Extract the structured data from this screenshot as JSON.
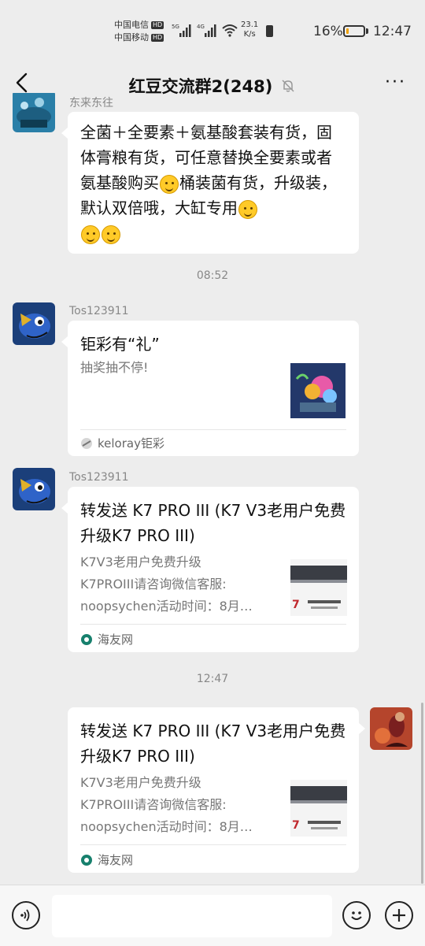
{
  "status_bar": {
    "carrier1": "中国电信",
    "carrier2": "中国移动",
    "hd": "HD",
    "sig1_label": "5G",
    "sig2_label": "4G",
    "net_speed": "23.1",
    "net_unit": "K/s",
    "battery": "16%",
    "time": "12:47",
    "battery_level_percent": 16
  },
  "header": {
    "title": "红豆交流群2(248)",
    "muted_icon": "bell-off-icon",
    "more_label": "···"
  },
  "messages": {
    "m0": {
      "sender": "东来东往",
      "text_before": "全菌＋全要素＋氨基酸套装有货，固体膏粮有货，可任意替换全要素或者氨基酸购买",
      "text_middle": "桶装菌有货，升级装，默认双倍哦，大缸专用",
      "emoji_icons": [
        "grin-icon",
        "smirk-icon",
        "smirk-icon",
        "smirk-icon"
      ]
    },
    "t1": "08:52",
    "m1": {
      "sender": "Tos123911",
      "title": "钜彩有“礼”",
      "desc": "抽奖抽不停!",
      "source": "keloray钜彩"
    },
    "m2": {
      "sender": "Tos123911",
      "title": "转发送 K7 PRO III (K7 V3老用户免费升级K7 PRO III)",
      "desc1": "K7V3老用户免费升级",
      "desc2": "K7PROIII请咨询微信客服:",
      "desc3": "noopsychen活动时间：8月…",
      "source": "海友网"
    },
    "t2": "12:47",
    "m3": {
      "title": "转发送 K7 PRO III (K7 V3老用户免费升级K7 PRO III)",
      "desc1": "K7V3老用户免费升级",
      "desc2": "K7PROIII请咨询微信客服:",
      "desc3": "noopsychen活动时间：8月…",
      "source": "海友网"
    }
  },
  "input": {
    "value": ""
  },
  "colors": {
    "bg": "#ededed",
    "bubble": "#ffffff",
    "battery_fill": "#f0a000"
  }
}
